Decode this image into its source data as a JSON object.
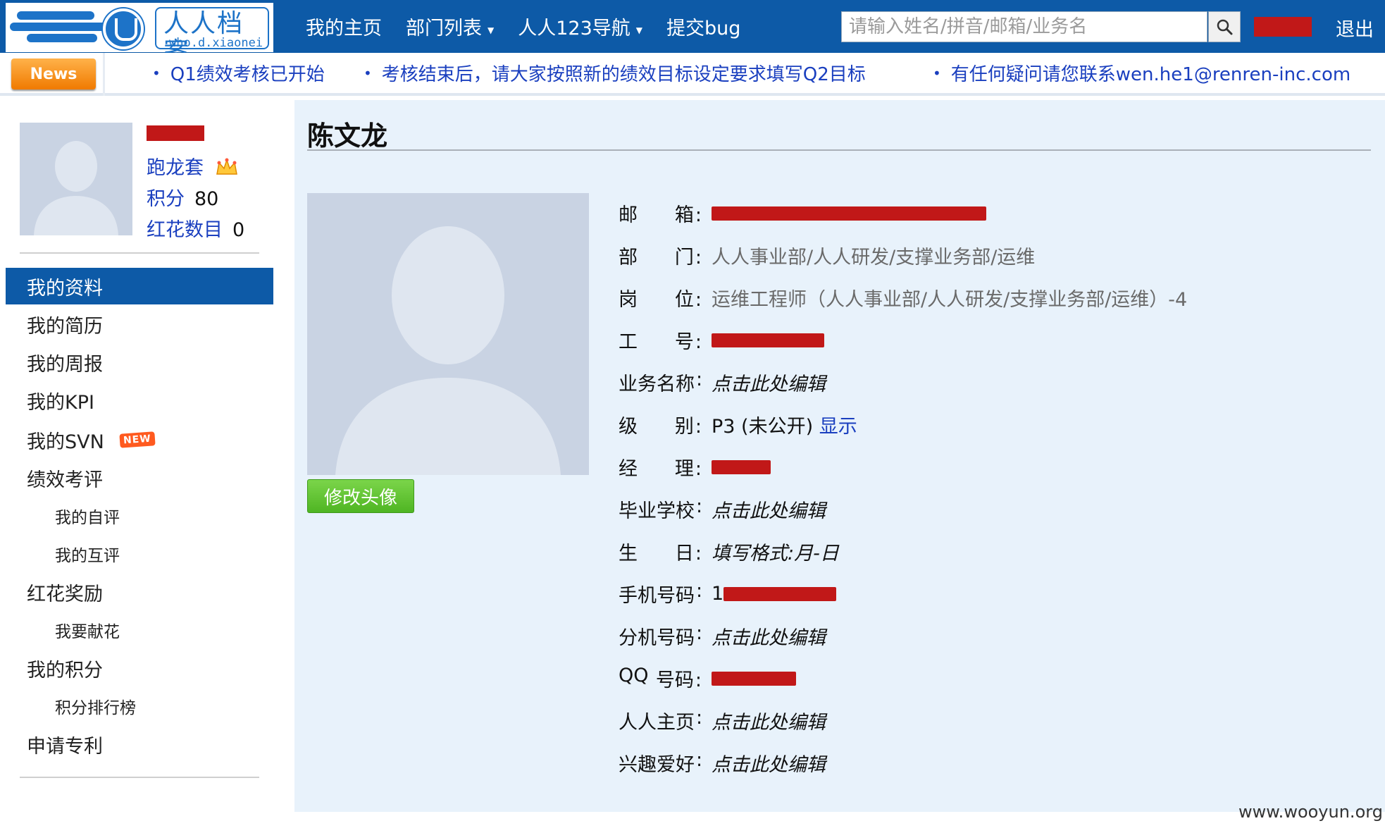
{
  "header": {
    "logo_text": "人人档案",
    "logo_sub": "who.d.xiaonei",
    "nav": [
      {
        "label": "我的主页",
        "dropdown": false
      },
      {
        "label": "部门列表",
        "dropdown": true
      },
      {
        "label": "人人123导航",
        "dropdown": true
      },
      {
        "label": "提交bug",
        "dropdown": false
      }
    ],
    "search_placeholder": "请输入姓名/拼音/邮箱/业务名",
    "logout": "退出",
    "colors": {
      "bar": "#0d5aa7",
      "accent": "#1d73c8"
    }
  },
  "news": {
    "badge": "News",
    "items": [
      "Q1绩效考核已开始",
      "考核结束后，请大家按照新的绩效目标设定要求填写Q2目标",
      "有任何疑问请您联系wen.he1@renren-inc.com"
    ]
  },
  "sidebar": {
    "nickname": "跑龙套",
    "points_label": "积分",
    "points_value": "80",
    "flowers_label": "红花数目",
    "flowers_value": "0",
    "menu": [
      {
        "label": "我的资料",
        "level": 1,
        "active": true
      },
      {
        "label": "我的简历",
        "level": 1
      },
      {
        "label": "我的周报",
        "level": 1
      },
      {
        "label": "我的KPI",
        "level": 1
      },
      {
        "label": "我的SVN",
        "level": 1,
        "badge": "NEW"
      },
      {
        "label": "绩效考评",
        "level": 1
      },
      {
        "label": "我的自评",
        "level": 2
      },
      {
        "label": "我的互评",
        "level": 2
      },
      {
        "label": "红花奖励",
        "level": 1
      },
      {
        "label": "我要献花",
        "level": 2
      },
      {
        "label": "我的积分",
        "level": 1
      },
      {
        "label": "积分排行榜",
        "level": 2
      },
      {
        "label": "申请专利",
        "level": 1
      }
    ]
  },
  "profile": {
    "name": "陈文龙",
    "edit_avatar": "修改头像",
    "fields": {
      "email": {
        "l1": "邮",
        "l2": "箱",
        "colon": ":"
      },
      "dept": {
        "l1": "部",
        "l2": "门",
        "colon": ":",
        "value": "人人事业部/人人研发/支撑业务部/运维"
      },
      "position": {
        "l1": "岗",
        "l2": "位",
        "colon": ":",
        "value": "运维工程师（人人事业部/人人研发/支撑业务部/运维）-4"
      },
      "empno": {
        "l1": "工",
        "l2": "号",
        "colon": ":"
      },
      "bizname": {
        "l1": "业务名称",
        "colon": ":",
        "value": "点击此处编辑"
      },
      "level": {
        "l1": "级",
        "l2": "别",
        "colon": ":",
        "value": "P3 (未公开)",
        "link": "显示"
      },
      "manager": {
        "l1": "经",
        "l2": "理",
        "colon": ":"
      },
      "school": {
        "l1": "毕业学校",
        "colon": ":",
        "value": "点击此处编辑"
      },
      "birthday": {
        "l1": "生",
        "l2": "日",
        "colon": ":",
        "value": "填写格式:月-日"
      },
      "mobile": {
        "l1": "手机号码",
        "colon": ":",
        "prefix": "1"
      },
      "ext": {
        "l1": "分机号码",
        "colon": ":",
        "value": "点击此处编辑"
      },
      "qq": {
        "l1": "QQ",
        "l2": "号码",
        "colon": ":"
      },
      "homepage": {
        "l1": "人人主页",
        "colon": ":",
        "value": "点击此处编辑"
      },
      "hobby": {
        "l1": "兴趣爱好",
        "colon": ":",
        "value": "点击此处编辑"
      }
    }
  },
  "watermark": "www.wooyun.org"
}
